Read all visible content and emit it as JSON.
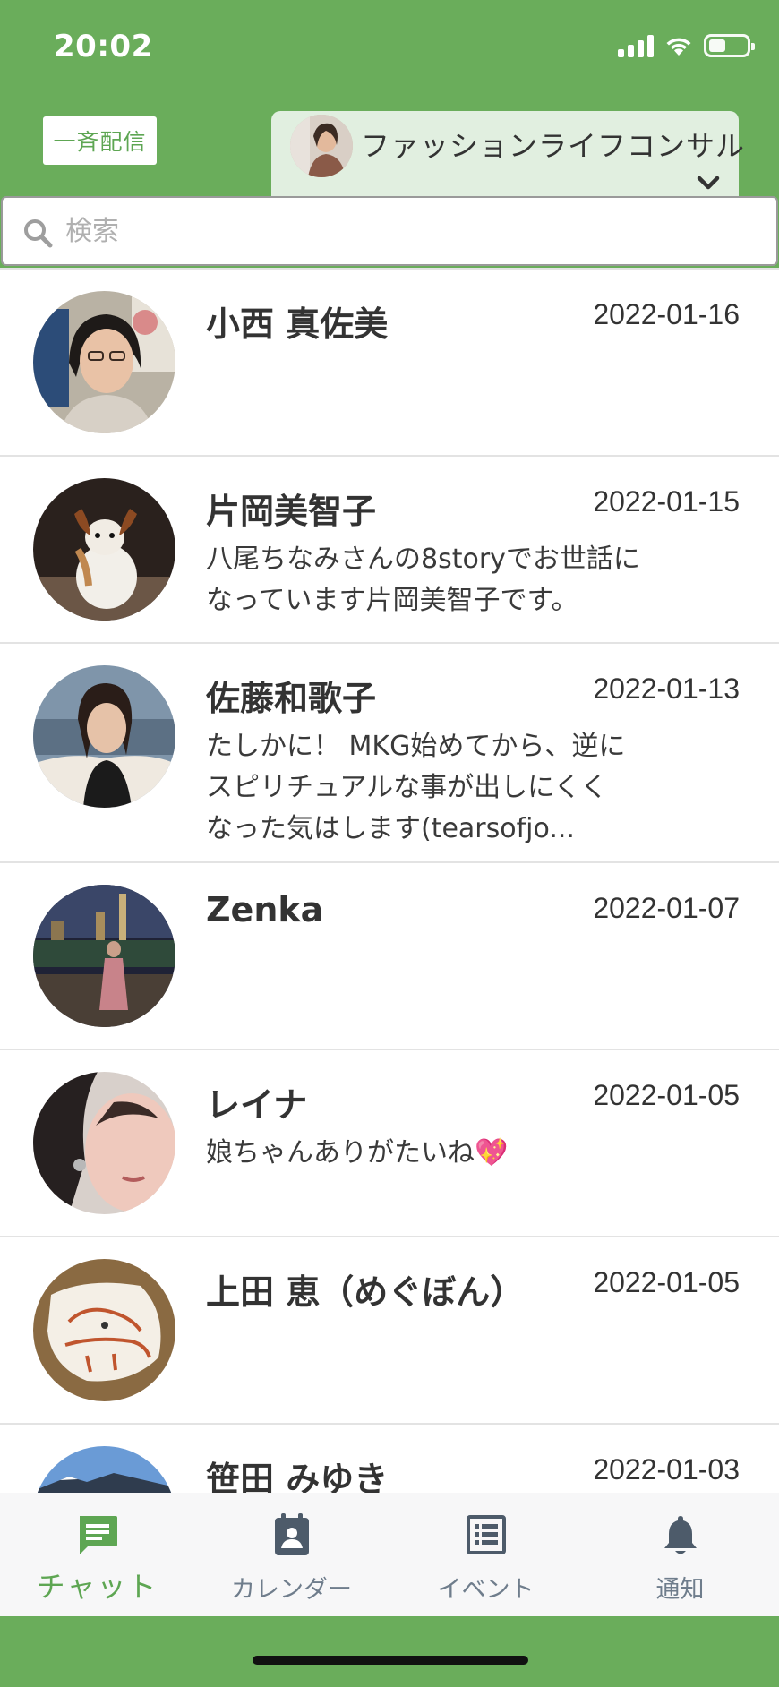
{
  "status_bar": {
    "time": "20:02"
  },
  "header": {
    "broadcast_label": "一斉配信",
    "account_name": "ファッションライフコンサル"
  },
  "search": {
    "placeholder": "検索"
  },
  "chats": [
    {
      "name": "小西 真佐美",
      "date": "2022-01-16",
      "preview": ""
    },
    {
      "name": "片岡美智子",
      "date": "2022-01-15",
      "preview": "八尾ちなみさんの8storyでお世話に\nなっています片岡美智子です。"
    },
    {
      "name": "佐藤和歌子",
      "date": "2022-01-13",
      "preview": "たしかに！ MKG始めてから、逆に\nスピリチュアルな事が出しにくく\nなった気はします(tearsofjo..."
    },
    {
      "name": "Zenka",
      "date": "2022-01-07",
      "preview": ""
    },
    {
      "name": "レイナ",
      "date": "2022-01-05",
      "preview": "娘ちゃんありがたいね💖"
    },
    {
      "name": "上田 恵（めぐぼん）",
      "date": "2022-01-05",
      "preview": ""
    },
    {
      "name": "笹田 みゆき",
      "date": "2022-01-03",
      "preview": ""
    }
  ],
  "tabs": [
    {
      "label": "チャット",
      "active": true
    },
    {
      "label": "カレンダー",
      "active": false
    },
    {
      "label": "イベント",
      "active": false
    },
    {
      "label": "通知",
      "active": false
    }
  ],
  "colors": {
    "brand_green": "#6aad5b",
    "active_tab": "#5ea653",
    "inactive_tab": "#6f7d8c"
  }
}
